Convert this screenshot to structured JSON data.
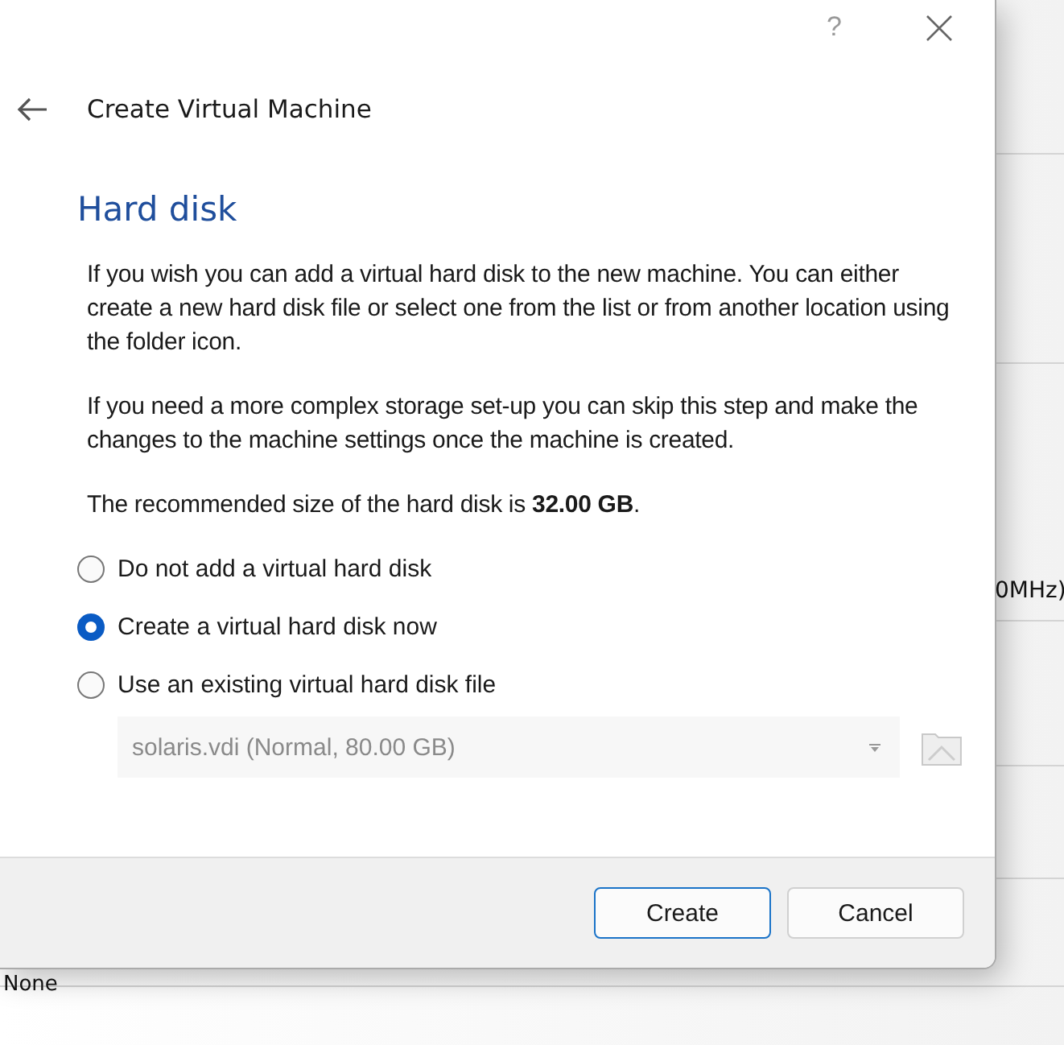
{
  "background": {
    "texts": [
      "0MHz)",
      "None"
    ]
  },
  "dialog": {
    "help": "?",
    "title": "Create Virtual Machine",
    "heading": "Hard disk",
    "paragraphs": [
      "If you wish you can add a virtual hard disk to the new machine. You can either create a new hard disk file or select one from the list or from another location using the folder icon.",
      "If you need a more complex storage set-up you can skip this step and make the changes to the machine settings once the machine is created.",
      "The recommended size of the hard disk is **32.00 GB**."
    ],
    "options": [
      {
        "label": "Do not add a virtual hard disk",
        "selected": false
      },
      {
        "label": "Create a virtual hard disk now",
        "selected": true
      },
      {
        "label": "Use an existing virtual hard disk file",
        "selected": false
      }
    ],
    "file_combo": {
      "value": "solaris.vdi (Normal, 80.00 GB)",
      "disabled": true
    },
    "buttons": [
      {
        "label": "Create",
        "default": true
      },
      {
        "label": "Cancel",
        "default": false
      }
    ]
  }
}
